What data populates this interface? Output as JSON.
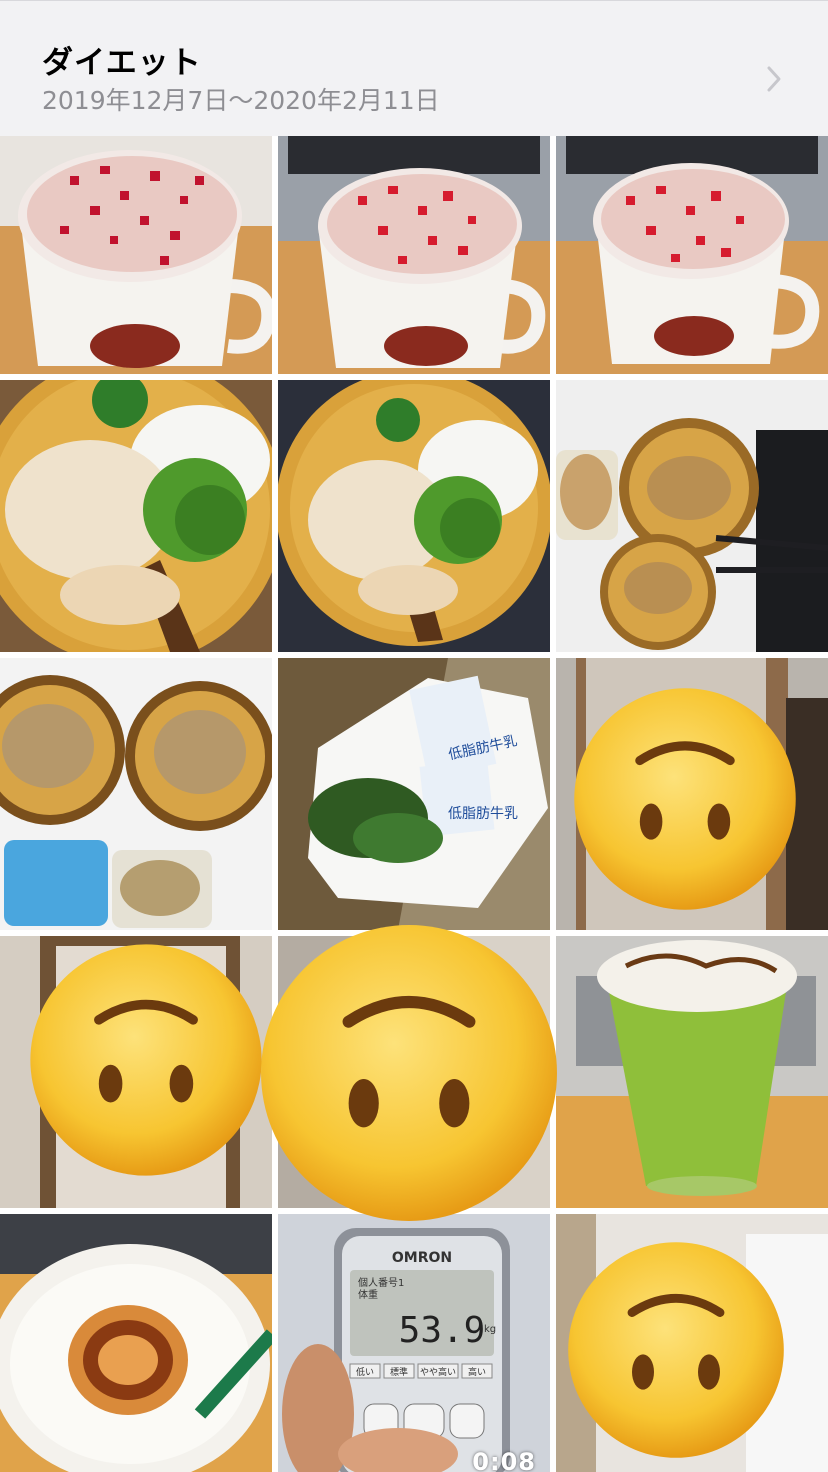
{
  "album": {
    "title": "ダイエット",
    "date_range": "2019年12月7日〜2020年2月11日"
  },
  "icons": {
    "chevron": "chevron-right-icon",
    "face": "upside-down-face-icon"
  },
  "photos": [
    {
      "subject": "strawberry-latte-1"
    },
    {
      "subject": "strawberry-latte-2"
    },
    {
      "subject": "strawberry-latte-3"
    },
    {
      "subject": "chicken-broccoli-rice-1"
    },
    {
      "subject": "chicken-broccoli-rice-2"
    },
    {
      "subject": "spinach-chicken-plates"
    },
    {
      "subject": "meal-prep-containers"
    },
    {
      "subject": "groceries-bag"
    },
    {
      "subject": "mirror-selfie-1"
    },
    {
      "subject": "mirror-selfie-2"
    },
    {
      "subject": "mirror-selfie-3"
    },
    {
      "subject": "matcha-frappe"
    },
    {
      "subject": "caramel-frappe"
    },
    {
      "subject": "body-scale"
    },
    {
      "subject": "mirror-selfie-4"
    }
  ],
  "groceries": {
    "carton_label": "低脂肪牛乳",
    "carton_label_2": "低脂肪牛乳"
  },
  "scale": {
    "brand": "OMRON",
    "weight": "53.9",
    "unit": "kg",
    "label_1": "個人番号1",
    "label_2": "体重",
    "levels": [
      "低い",
      "標準",
      "やや高い",
      "高い"
    ]
  },
  "video": {
    "duration": "0:08"
  },
  "colors": {
    "header_bg": "#f2f2f4",
    "date_gray": "#8e8e93",
    "plate": "#d9a13a",
    "matcha": "#8fbf3a",
    "emoji": "#f7c531"
  }
}
